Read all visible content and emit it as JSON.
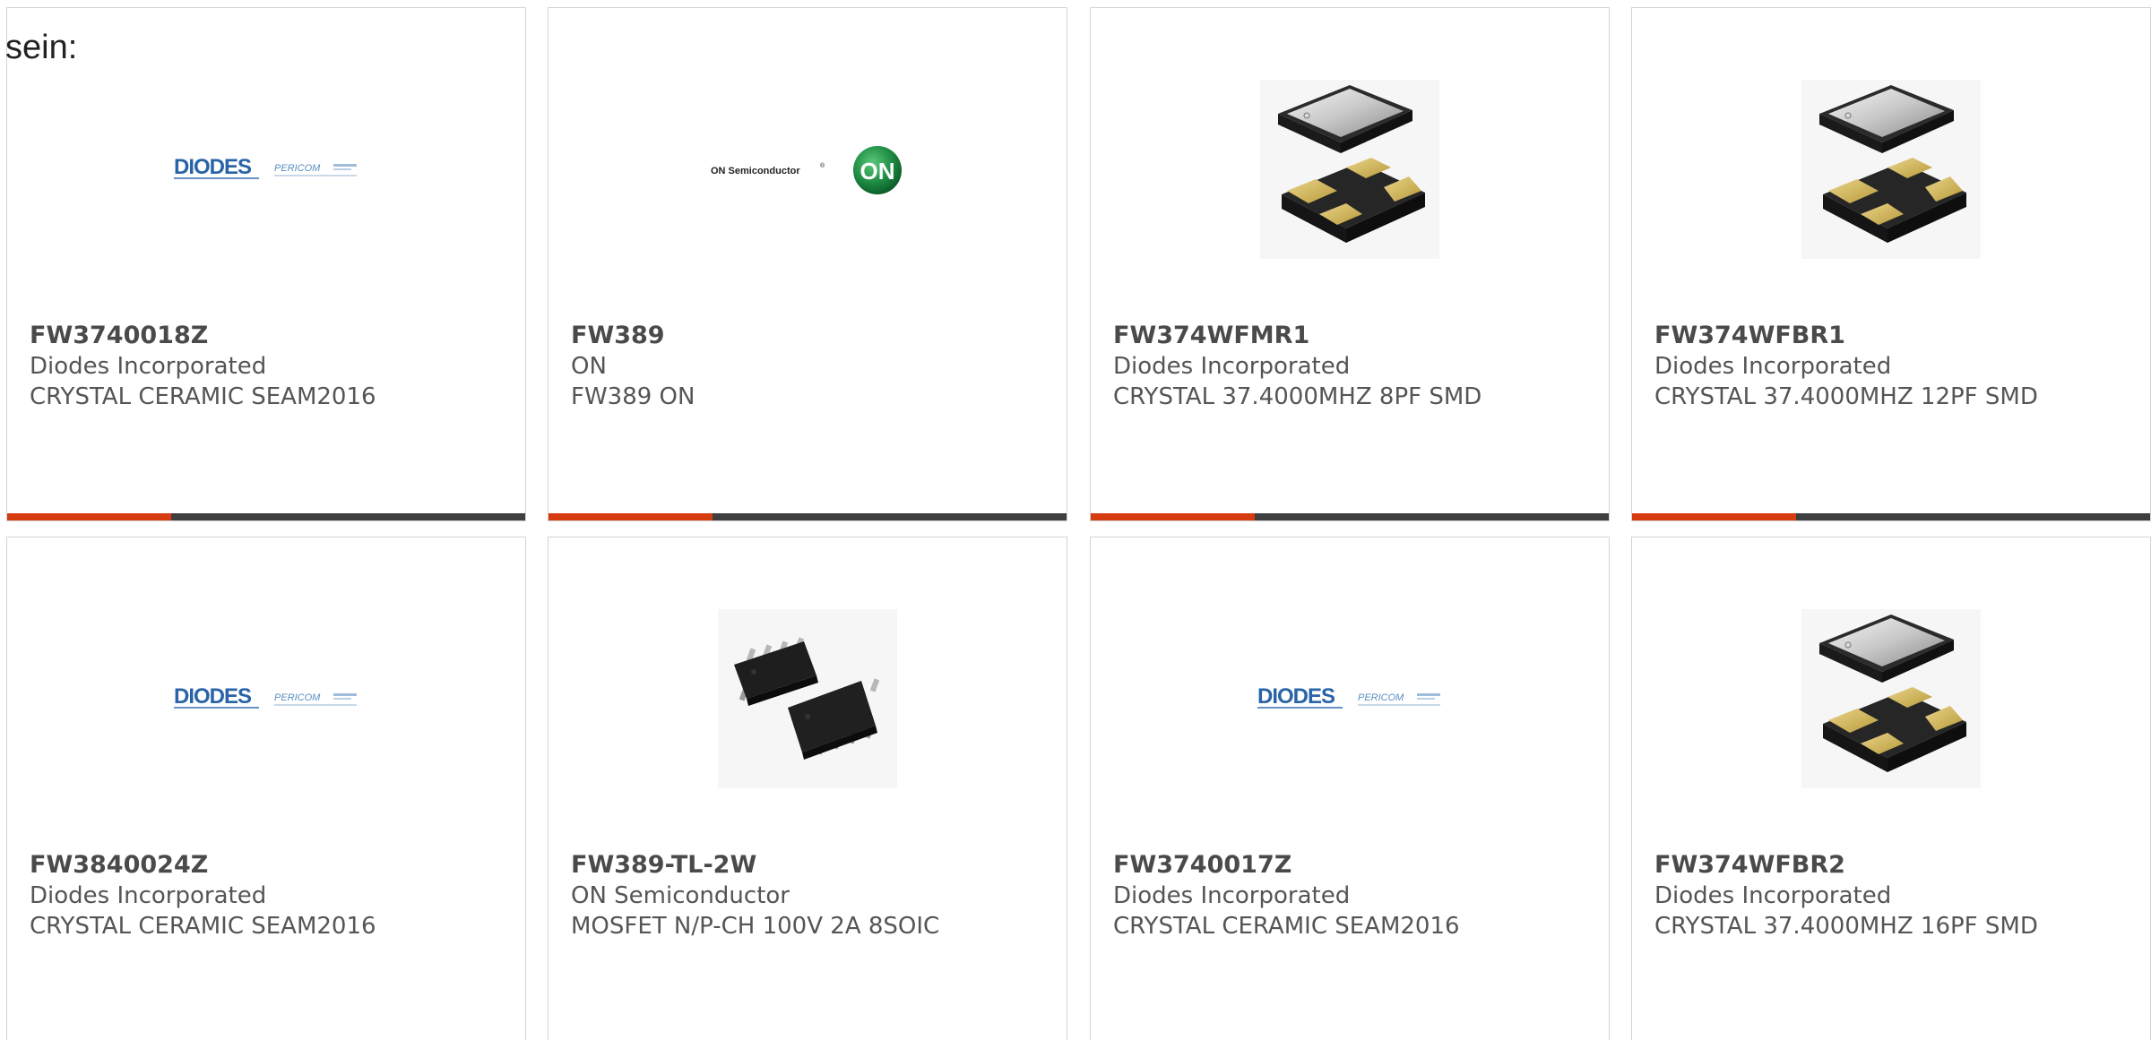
{
  "intro": {
    "text": "sein:"
  },
  "theme": {
    "accent": "#d63c10",
    "bar": "#3f3f3f",
    "border": "#d3d3d3"
  },
  "cards": [
    {
      "part": "FW3740018Z",
      "maker": "Diodes Incorporated",
      "desc": "CRYSTAL CERAMIC SEAM2016",
      "image": "diodes-pericom-logo",
      "logo_main": "DIODES",
      "logo_sub": "PERICOM"
    },
    {
      "part": "FW389",
      "maker": "ON",
      "desc": "FW389 ON",
      "image": "on-semiconductor-logo",
      "logo_main": "ON Semiconductor",
      "logo_sub": "ON"
    },
    {
      "part": "FW374WFMR1",
      "maker": "Diodes Incorporated",
      "desc": "CRYSTAL 37.4000MHZ 8PF SMD",
      "image": "crystal-smd-photo",
      "logo_main": "",
      "logo_sub": ""
    },
    {
      "part": "FW374WFBR1",
      "maker": "Diodes Incorporated",
      "desc": "CRYSTAL 37.4000MHZ 12PF SMD",
      "image": "crystal-smd-photo",
      "logo_main": "",
      "logo_sub": ""
    },
    {
      "part": "FW3840024Z",
      "maker": "Diodes Incorporated",
      "desc": "CRYSTAL CERAMIC SEAM2016",
      "image": "diodes-pericom-logo",
      "logo_main": "DIODES",
      "logo_sub": "PERICOM"
    },
    {
      "part": "FW389-TL-2W",
      "maker": "ON Semiconductor",
      "desc": "MOSFET N/P-CH 100V 2A 8SOIC",
      "image": "soic8-chip-photo",
      "logo_main": "",
      "logo_sub": ""
    },
    {
      "part": "FW3740017Z",
      "maker": "Diodes Incorporated",
      "desc": "CRYSTAL CERAMIC SEAM2016",
      "image": "diodes-pericom-logo",
      "logo_main": "DIODES",
      "logo_sub": "PERICOM"
    },
    {
      "part": "FW374WFBR2",
      "maker": "Diodes Incorporated",
      "desc": "CRYSTAL 37.4000MHZ 16PF SMD",
      "image": "crystal-smd-photo",
      "logo_main": "",
      "logo_sub": ""
    }
  ]
}
